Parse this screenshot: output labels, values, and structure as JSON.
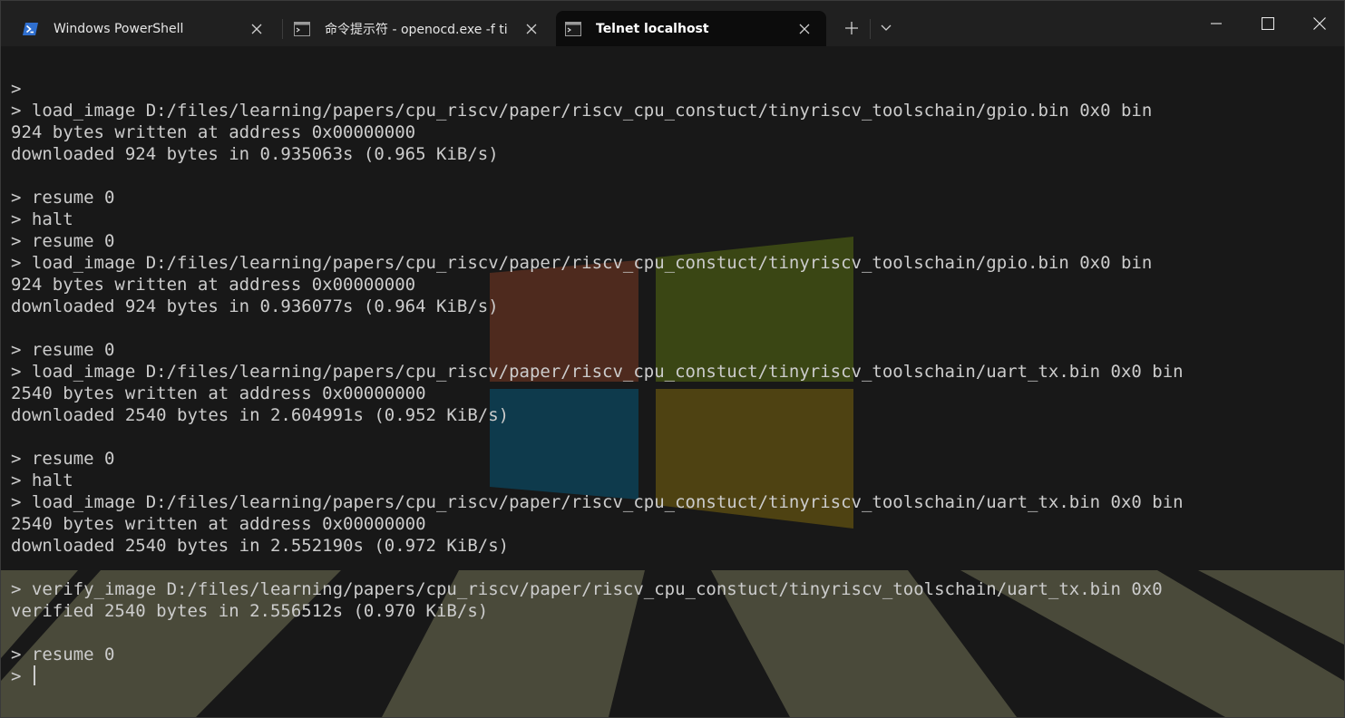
{
  "tabs": [
    {
      "label": "Windows PowerShell",
      "icon": "powershell-icon",
      "active": false
    },
    {
      "label": "命令提示符 - openocd.exe  -f ti",
      "icon": "cmd-icon",
      "active": false
    },
    {
      "label": "Telnet localhost",
      "icon": "cmd-icon",
      "active": true
    }
  ],
  "terminal": {
    "lines": [
      ">",
      "> load_image D:/files/learning/papers/cpu_riscv/paper/riscv_cpu_constuct/tinyriscv_toolschain/gpio.bin 0x0 bin",
      "924 bytes written at address 0x00000000",
      "downloaded 924 bytes in 0.935063s (0.965 KiB/s)",
      "",
      "> resume 0",
      "> halt",
      "> resume 0",
      "> load_image D:/files/learning/papers/cpu_riscv/paper/riscv_cpu_constuct/tinyriscv_toolschain/gpio.bin 0x0 bin",
      "924 bytes written at address 0x00000000",
      "downloaded 924 bytes in 0.936077s (0.964 KiB/s)",
      "",
      "> resume 0",
      "> load_image D:/files/learning/papers/cpu_riscv/paper/riscv_cpu_constuct/tinyriscv_toolschain/uart_tx.bin 0x0 bin",
      "2540 bytes written at address 0x00000000",
      "downloaded 2540 bytes in 2.604991s (0.952 KiB/s)",
      "",
      "> resume 0",
      "> halt",
      "> load_image D:/files/learning/papers/cpu_riscv/paper/riscv_cpu_constuct/tinyriscv_toolschain/uart_tx.bin 0x0 bin",
      "2540 bytes written at address 0x00000000",
      "downloaded 2540 bytes in 2.552190s (0.972 KiB/s)",
      "",
      "> verify_image D:/files/learning/papers/cpu_riscv/paper/riscv_cpu_constuct/tinyriscv_toolschain/uart_tx.bin 0x0",
      "verified 2540 bytes in 2.556512s (0.970 KiB/s)",
      "",
      "> resume 0"
    ],
    "prompt": "> "
  },
  "colors": {
    "logo_red": "#4e2a1e",
    "logo_green": "#3a4614",
    "logo_blue": "#0e3a4c",
    "logo_yellow": "#4e4212",
    "floor_stripe": "#4a4a3a",
    "text": "#cccccc"
  }
}
